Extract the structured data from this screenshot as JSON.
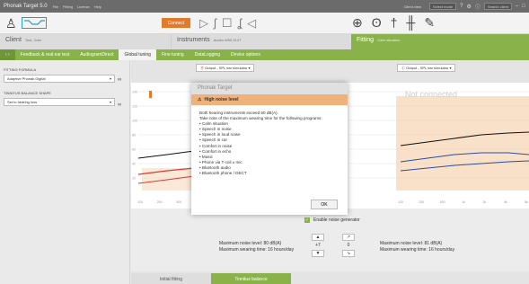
{
  "window": {
    "title": "Phonak Target 5.0",
    "menus": [
      "File",
      "Fitting",
      "License",
      "Help"
    ],
    "client_view_label": "Client view",
    "mode_select": "Select mode",
    "search_placeholder": "Search client"
  },
  "toolbar": {
    "connect_label": "Connect"
  },
  "info": {
    "client_label": "Client",
    "client_name": "Test, John",
    "instruments_label": "Instruments",
    "instruments_value": "Audéo M90-312T",
    "fitting_label": "Fitting",
    "fitting_sub": "Calm situation"
  },
  "tabs": [
    "Feedback & real ear test",
    "AudiogramDirect",
    "Global tuning",
    "Fine tuning",
    "DataLogging",
    "Device options"
  ],
  "left_panel": {
    "formula_label": "FITTING FORMULA",
    "formula_value": "Adaptive Phonak Digital",
    "shape_label": "TINNITUS BALANCE SHAPE",
    "shape_value": "Set to hearing loss"
  },
  "main": {
    "output_left": "Output - SPL ear simulator",
    "output_right": "Output - SPL ear simulator",
    "not_connected": "Not connected"
  },
  "chart_data": {
    "type": "line",
    "x": [
      "125",
      "250",
      "500",
      "1k",
      "2k",
      "4k",
      "8k"
    ],
    "ylabels": [
      "140",
      "120",
      "100",
      "80",
      "60",
      "40",
      "20"
    ]
  },
  "dialog": {
    "title": "Phonak Target",
    "warning": "High noise level",
    "intro": "Both hearing instruments exceed 80 dB(A).",
    "instruction": "Take note of the maximum wearing time for the following programs:",
    "programs": [
      "Calm situation",
      "Speech in noise",
      "Speech in loud noise",
      "Speech in car",
      "Comfort in noise",
      "Comfort in echo",
      "Music",
      "Phone via T-coil ± mic",
      "Bluetooth audio",
      "Bluetooth phone / DECT"
    ],
    "ok_label": "OK"
  },
  "noise": {
    "enable_label": "Enable noise generator",
    "left_level": "Maximum noise level: 80 dB(A)",
    "left_time": "Maximum wearing time: 16 hours/day",
    "right_level": "Maximum noise level: 81 dB(A)",
    "right_time": "Maximum wearing time: 16 hours/day",
    "left_value": "+7",
    "right_value": "0"
  },
  "bottom_tabs": [
    "Initial fitting",
    "Tinnitus balance"
  ],
  "colors": {
    "accent_green": "#8ab24a",
    "accent_orange": "#e17a2b",
    "warning_orange": "#f0b27a",
    "right_curve": "#d93a3a",
    "left_curve": "#2a4ea0"
  }
}
